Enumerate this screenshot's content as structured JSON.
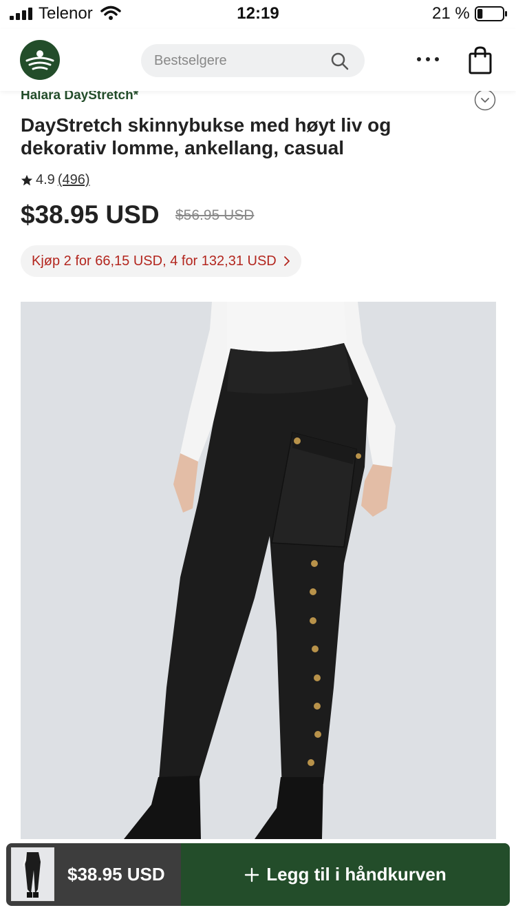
{
  "status_bar": {
    "carrier": "Telenor",
    "time": "12:19",
    "battery": "21 %",
    "battery_level": 0.21
  },
  "header": {
    "search_placeholder": "Bestselgere",
    "icons": [
      "logo-icon",
      "search-icon",
      "more-icon",
      "shopping-bag-icon"
    ]
  },
  "product": {
    "brand": "Halara DayStretch*",
    "title": "DayStretch skinnybukse med høyt liv og dekorativ lomme, ankellang, casual",
    "rating": "4.9",
    "review_count": "(496)",
    "price": "$38.95 USD",
    "original_price": "$56.95 USD",
    "promo": "Kjøp 2 for 66,15 USD, 4 for 132,31 USD"
  },
  "bottom_bar": {
    "price": "$38.95 USD",
    "add_to_cart": "Legg til i håndkurven"
  },
  "colors": {
    "brand_green": "#234d2a",
    "promo_red": "#b3261e",
    "bottom_bar_dark": "#3d3d3d"
  }
}
